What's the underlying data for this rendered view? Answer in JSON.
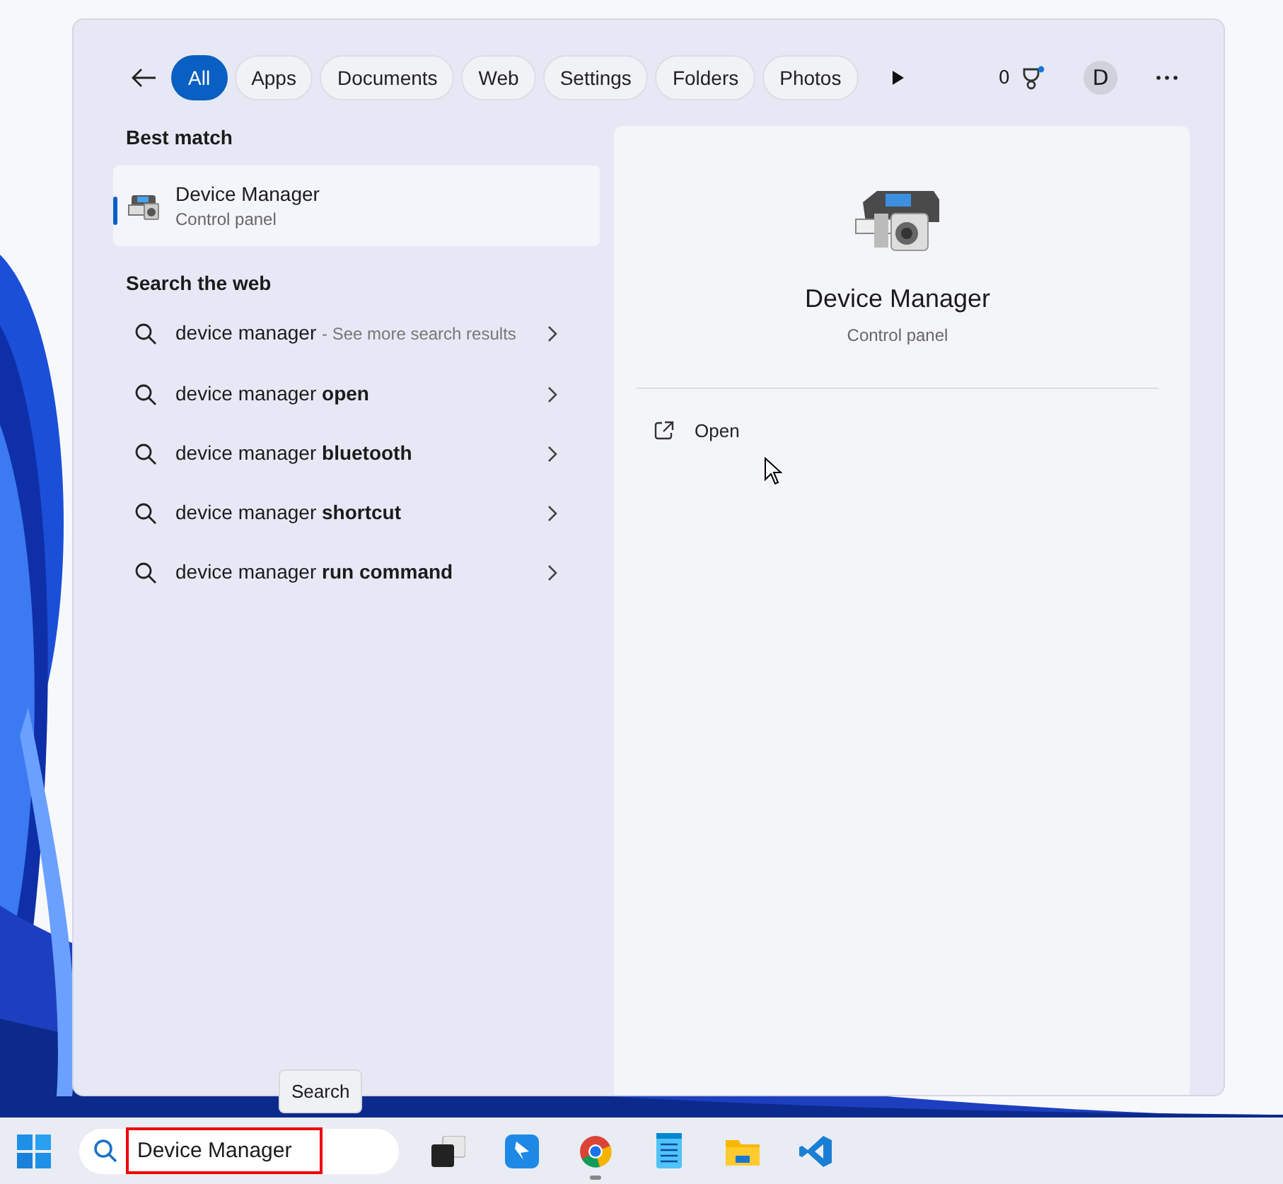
{
  "filters": [
    {
      "label": "All",
      "selected": true
    },
    {
      "label": "Apps",
      "selected": false
    },
    {
      "label": "Documents",
      "selected": false
    },
    {
      "label": "Web",
      "selected": false
    },
    {
      "label": "Settings",
      "selected": false
    },
    {
      "label": "Folders",
      "selected": false
    },
    {
      "label": "Photos",
      "selected": false
    }
  ],
  "header": {
    "points": "0",
    "avatar": "D"
  },
  "best_match": {
    "heading": "Best match",
    "title": "Device Manager",
    "subtitle": "Control panel",
    "selected": true
  },
  "web": {
    "heading": "Search the web",
    "results": [
      {
        "text": "device manager",
        "note": "- See more search results"
      },
      {
        "text": "device manager **open**"
      },
      {
        "text": "device manager **bluetooth**"
      },
      {
        "text": "device manager **shortcut**"
      },
      {
        "text": "device manager **run command**"
      }
    ]
  },
  "preview": {
    "title": "Device Manager",
    "subtitle": "Control panel",
    "actions": [
      "Open"
    ]
  },
  "tooltip": "Search",
  "taskbar": {
    "search": {
      "value": "Device Manager",
      "highlighted": true
    },
    "apps": [
      {
        "kind": "taskview",
        "running": false
      },
      {
        "kind": "bird",
        "running": false
      },
      {
        "kind": "chrome",
        "running": true
      },
      {
        "kind": "notepad",
        "running": false
      },
      {
        "kind": "folder",
        "running": false
      },
      {
        "kind": "code",
        "running": false
      }
    ]
  }
}
